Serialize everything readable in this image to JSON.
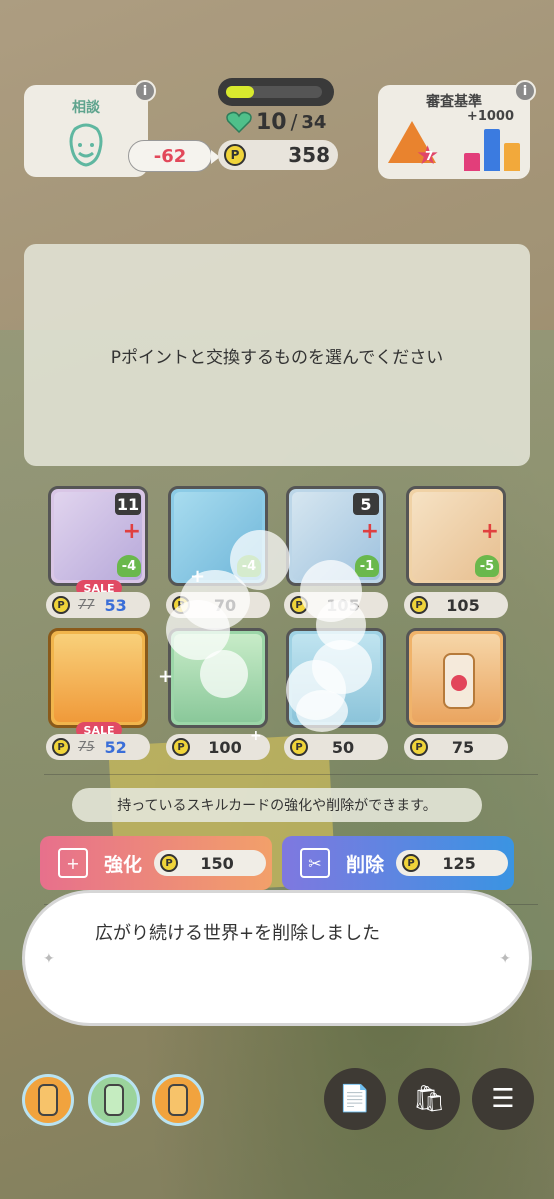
{
  "hud": {
    "consult_label": "相談",
    "stamina_current": "10",
    "stamina_separator": "/",
    "stamina_max": "34",
    "stamina_fraction": 0.29,
    "p_icon": "P",
    "p_points": "358",
    "p_diff": "-62",
    "criteria_label": "審査基準",
    "criteria_bonus": "+1000",
    "criteria_rank": "7"
  },
  "message": "Pポイントと交換するものを選んでください",
  "items": [
    {
      "name": "card-1",
      "badge": "11",
      "heart": "-4",
      "sale": "SALE",
      "old_price": "77",
      "price": "53"
    },
    {
      "name": "card-2",
      "heart": "-4",
      "price": "70"
    },
    {
      "name": "card-3",
      "badge": "5",
      "heart": "-1",
      "price": "105"
    },
    {
      "name": "card-4",
      "heart": "-5",
      "price": "105"
    },
    {
      "name": "drink-1",
      "sale": "SALE",
      "old_price": "75",
      "price": "52"
    },
    {
      "name": "drink-2",
      "price": "100"
    },
    {
      "name": "drink-3",
      "price": "50"
    },
    {
      "name": "drink-4",
      "price": "75"
    }
  ],
  "hint": "持っているスキルカードの強化や削除ができます。",
  "actions": {
    "enhance_label": "強化",
    "enhance_cost": "150",
    "delete_label": "削除",
    "delete_cost": "125"
  },
  "toast": "広がり続ける世界+を削除しました",
  "colors": {
    "enhance": "#e4738a",
    "delete": "#3d8fe0",
    "sale": "#e14a64",
    "price_sale": "#3a6ed8"
  },
  "bottom": {
    "menu_icons": [
      "memo-icon",
      "shop-bag-icon",
      "menu-icon"
    ]
  }
}
